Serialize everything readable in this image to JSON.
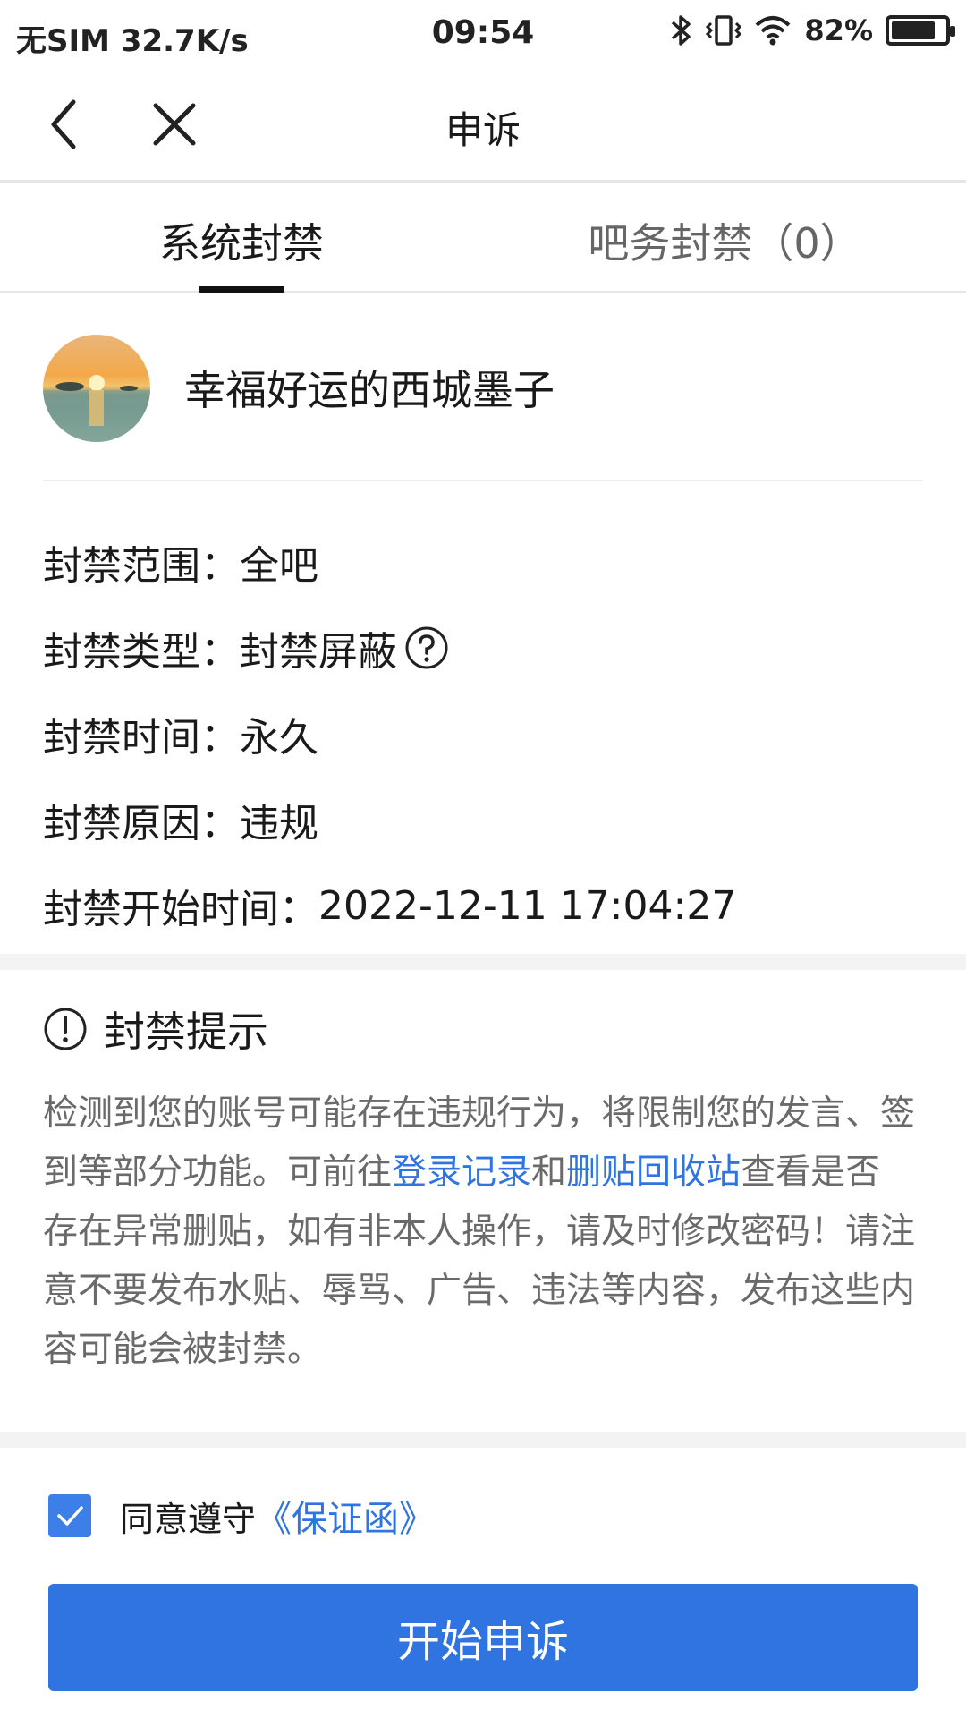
{
  "status_bar": {
    "carrier": "无SIM 32.7K/s",
    "time": "09:54",
    "battery": "82%",
    "battery_level": 0.82,
    "icons": [
      "bluetooth-icon",
      "vibrate-icon",
      "wifi-icon",
      "battery-icon"
    ]
  },
  "nav": {
    "title": "申诉",
    "icons": [
      "back-arrow-icon",
      "close-icon"
    ]
  },
  "tabs": [
    {
      "label": "系统封禁",
      "active": true
    },
    {
      "label": "吧务封禁（0）",
      "active": false
    }
  ],
  "user": {
    "name": "幸福好运的西城墨子"
  },
  "info": [
    {
      "label": "封禁范围：",
      "value": "全吧"
    },
    {
      "label": "封禁类型：",
      "value": "封禁屏蔽"
    },
    {
      "label": "封禁时间：",
      "value": "永久"
    },
    {
      "label": "封禁原因：",
      "value": "违规"
    },
    {
      "label": "封禁开始时间：",
      "value": "2022-12-11 17:04:27"
    }
  ],
  "tips": {
    "title": "封禁提示",
    "part1": "检测到您的账号可能存在违规行为，将限制您的发言、签到等部分功能。可前往",
    "link1": "登录记录",
    "part2": "和",
    "link2": "删贴回收站",
    "part3": "查看是否存在异常删贴，如有非本人操作，请及时修改密码！请注意不要发布水贴、辱骂、广告、违法等内容，发布这些内容可能会被封禁。"
  },
  "agree": {
    "checked": true,
    "text": "同意遵守",
    "link": "《保证函》"
  },
  "button": {
    "label": "开始申诉"
  },
  "colors": {
    "accent": "#2f74e0",
    "checkbox": "#3c7fe8",
    "muted_text": "#6a6a6a"
  }
}
